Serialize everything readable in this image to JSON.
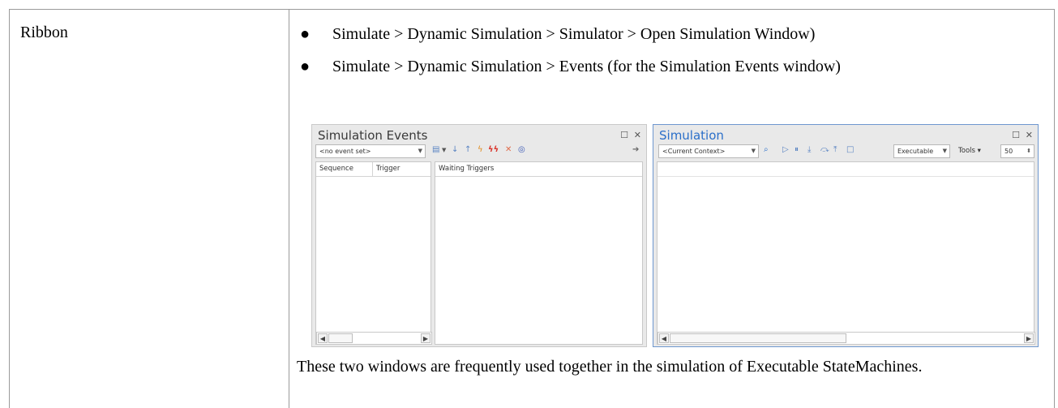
{
  "row": {
    "label": "Ribbon",
    "bullets": [
      "Simulate > Dynamic Simulation > Simulator > Open Simulation Window)",
      "Simulate > Dynamic Simulation > Events    (for the Simulation Events window)"
    ],
    "note": "These two windows are frequently used together in the simulation of Executable StateMachines."
  },
  "events_window": {
    "title": "Simulation Events",
    "event_set": "<no event set>",
    "columns": [
      "Sequence",
      "Trigger",
      "Waiting Triggers"
    ],
    "icons": [
      "list-icon",
      "dropdown-arrow-icon",
      "down-arrow-icon",
      "up-arrow-icon",
      "lightning-icon",
      "double-lightning-icon",
      "delete-icon",
      "target-icon",
      "export-icon"
    ]
  },
  "sim_window": {
    "title": "Simulation",
    "context": "<Current Context>",
    "mode": "Executable",
    "tools_label": "Tools",
    "speed": "50",
    "icons": [
      "search-icon",
      "run-icon",
      "pause-icon",
      "step-in-icon",
      "step-over-icon",
      "step-out-icon",
      "stop-icon"
    ]
  }
}
